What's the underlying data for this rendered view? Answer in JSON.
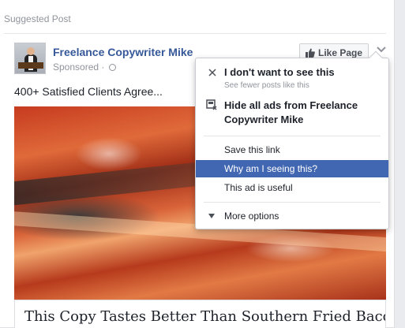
{
  "post": {
    "suggested_label": "Suggested Post",
    "page_name": "Freelance Copywriter Mike",
    "sponsored_label": "Sponsored ·",
    "like_page_label": "Like Page",
    "caption": "400+ Satisfied Clients Agree...",
    "headline": "This Copy Tastes Better Than Southern Fried Bacon!"
  },
  "menu": {
    "hide_post": {
      "title": "I don't want to see this",
      "subtitle": "See fewer posts like this"
    },
    "hide_all_ads": {
      "title_line1": "Hide all ads from Freelance",
      "title_line2": "Copywriter Mike"
    },
    "items": [
      {
        "label": "Save this link"
      },
      {
        "label": "Why am I seeing this?",
        "active": true
      },
      {
        "label": "This ad is useful"
      }
    ],
    "more_options": "More options"
  },
  "icons": {
    "close": "close-icon",
    "hide_ads": "hide-ads-icon",
    "thumb": "thumbs-up-icon",
    "chevron": "chevron-down-icon",
    "globe": "globe-icon",
    "caret": "caret-down-icon"
  },
  "colors": {
    "link": "#365899",
    "highlight": "#4267b2",
    "muted": "#90949c"
  }
}
